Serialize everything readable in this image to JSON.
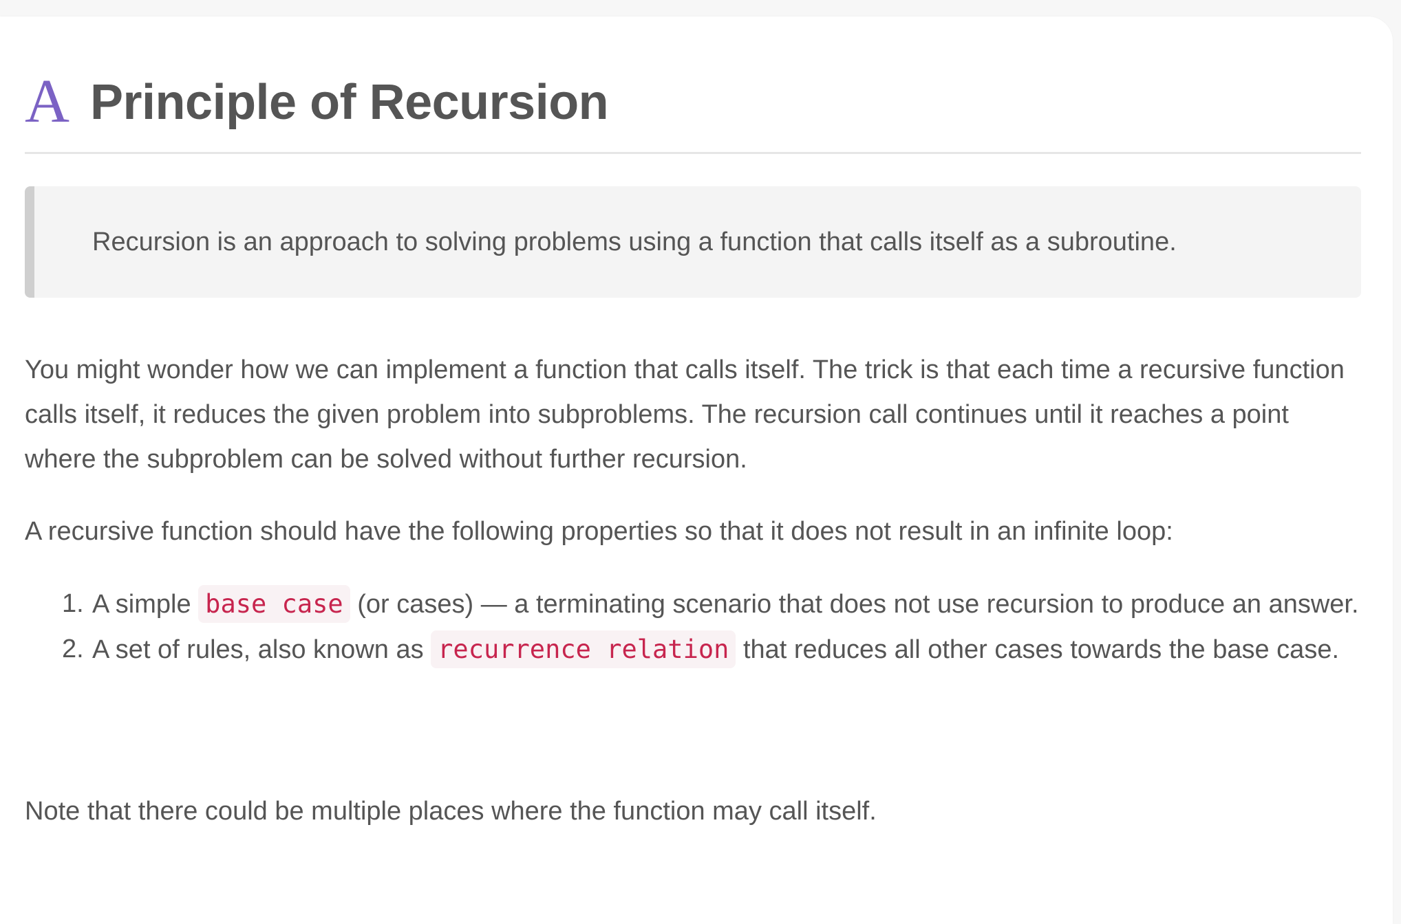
{
  "header": {
    "icon_letter": "A",
    "title": "Principle of Recursion"
  },
  "blockquote": {
    "text": "Recursion is an approach to solving problems using a function that calls itself as a subroutine."
  },
  "paragraphs": {
    "p1": "You might wonder how we can implement a function that calls itself. The trick is that each time a recursive function calls itself, it reduces the given problem into subproblems. The recursion call continues until it reaches a point where the subproblem can be solved without further recursion.",
    "p2": "A recursive function should have the following properties so that it does not result in an infinite loop:",
    "p3": "Note that there could be multiple places where the function may call itself."
  },
  "list": [
    {
      "number": "1.",
      "before": "A simple ",
      "code": "base case",
      "after": " (or cases) — a terminating scenario that does not use recursion to produce an answer."
    },
    {
      "number": "2.",
      "before": "A set of rules, also known as ",
      "code": "recurrence relation",
      "after": " that reduces all other cases towards the base case."
    }
  ],
  "colors": {
    "icon_accent": "#7b62c4",
    "code_text": "#c7254e",
    "code_bg": "#f9f2f4",
    "body_text": "#555555"
  }
}
